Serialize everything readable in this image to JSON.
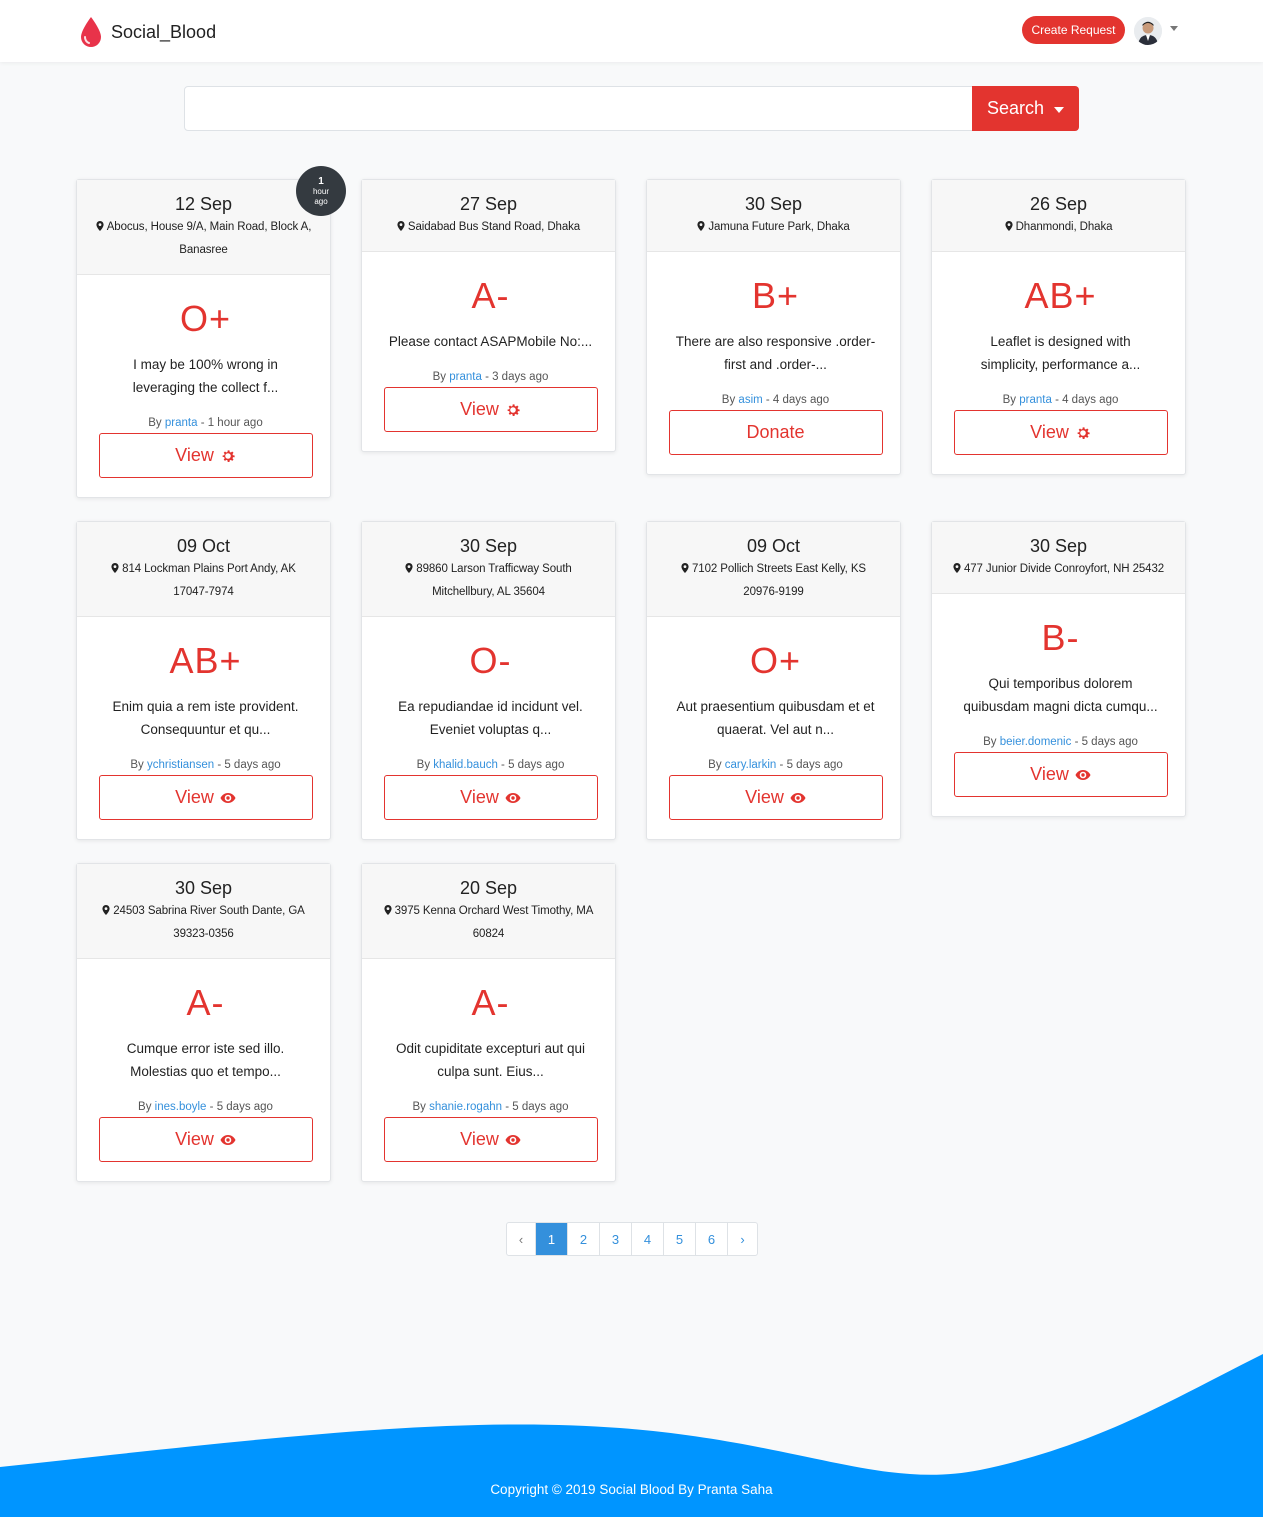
{
  "navbar": {
    "brand": "Social_Blood",
    "create_request": "Create Request"
  },
  "search": {
    "placeholder": "",
    "button_label": "Search"
  },
  "colors": {
    "accent": "#e3342f",
    "link": "#3490dc",
    "footer": "#0095ff"
  },
  "badge": {
    "num": "1",
    "unit1": "hour",
    "unit2": "ago"
  },
  "cards": [
    {
      "date": "12 Sep",
      "loc1": "Abocus, House 9/A, Main Road, Block A,",
      "loc2": "Banasree",
      "blood": "O+",
      "desc1": "I may be 100% wrong in",
      "desc2": "leveraging the collect f...",
      "by": "By ",
      "user": "pranta",
      "ago": " - 1 hour ago",
      "btn": "View",
      "btn_icon": "gear-icon"
    },
    {
      "date": "27 Sep",
      "loc1": "Saidabad Bus Stand Road, Dhaka",
      "loc2": "",
      "blood": "A-",
      "desc1": "Please contact ASAPMobile No:...",
      "desc2": "",
      "by": "By ",
      "user": "pranta",
      "ago": " - 3 days ago",
      "btn": "View",
      "btn_icon": "gear-icon"
    },
    {
      "date": "30 Sep",
      "loc1": "Jamuna Future Park, Dhaka",
      "loc2": "",
      "blood": "B+",
      "desc1": "There are also responsive .order-",
      "desc2": "first and .order-...",
      "by": "By ",
      "user": "asim",
      "ago": " - 4 days ago",
      "btn": "Donate",
      "btn_icon": ""
    },
    {
      "date": "26 Sep",
      "loc1": "Dhanmondi, Dhaka",
      "loc2": "",
      "blood": "AB+",
      "desc1": "Leaflet is designed with",
      "desc2": "simplicity, performance a...",
      "by": "By ",
      "user": "pranta",
      "ago": " - 4 days ago",
      "btn": "View",
      "btn_icon": "gear-icon"
    },
    {
      "date": "09 Oct",
      "loc1": "814 Lockman Plains Port Andy, AK",
      "loc2": "17047-7974",
      "blood": "AB+",
      "desc1": "Enim quia a rem iste provident.",
      "desc2": "Consequuntur et qu...",
      "by": "By ",
      "user": "ychristiansen",
      "ago": " - 5 days ago",
      "btn": "View",
      "btn_icon": "eye-icon"
    },
    {
      "date": "30 Sep",
      "loc1": "89860 Larson Trafficway South",
      "loc2": "Mitchellbury, AL 35604",
      "blood": "O-",
      "desc1": "Ea repudiandae id incidunt vel.",
      "desc2": "Eveniet voluptas q...",
      "by": "By ",
      "user": "khalid.bauch",
      "ago": " - 5 days ago",
      "btn": "View",
      "btn_icon": "eye-icon"
    },
    {
      "date": "09 Oct",
      "loc1": "7102 Pollich Streets East Kelly, KS",
      "loc2": "20976-9199",
      "blood": "O+",
      "desc1": "Aut praesentium quibusdam et et",
      "desc2": "quaerat. Vel aut n...",
      "by": "By ",
      "user": "cary.larkin",
      "ago": " - 5 days ago",
      "btn": "View",
      "btn_icon": "eye-icon"
    },
    {
      "date": "30 Sep",
      "loc1": "477 Junior Divide Conroyfort, NH 25432",
      "loc2": "",
      "blood": "B-",
      "desc1": "Qui temporibus dolorem",
      "desc2": "quibusdam magni dicta cumqu...",
      "by": "By ",
      "user": "beier.domenic",
      "ago": " - 5 days ago",
      "btn": "View",
      "btn_icon": "eye-icon"
    },
    {
      "date": "30 Sep",
      "loc1": "24503 Sabrina River South Dante, GA",
      "loc2": "39323-0356",
      "blood": "A-",
      "desc1": "Cumque error iste sed illo.",
      "desc2": "Molestias quo et tempo...",
      "by": "By ",
      "user": "ines.boyle",
      "ago": " - 5 days ago",
      "btn": "View",
      "btn_icon": "eye-icon"
    },
    {
      "date": "20 Sep",
      "loc1": "3975 Kenna Orchard West Timothy, MA",
      "loc2": "60824",
      "blood": "A-",
      "desc1": "Odit cupiditate excepturi aut qui",
      "desc2": "culpa sunt. Eius...",
      "by": "By ",
      "user": "shanie.rogahn",
      "ago": " - 5 days ago",
      "btn": "View",
      "btn_icon": "eye-icon"
    }
  ],
  "pagination": {
    "prev": "‹",
    "pages": [
      "1",
      "2",
      "3",
      "4",
      "5",
      "6"
    ],
    "next": "›",
    "active": "1"
  },
  "footer": {
    "copyright": "Copyright © 2019 Social Blood By Pranta Saha"
  }
}
